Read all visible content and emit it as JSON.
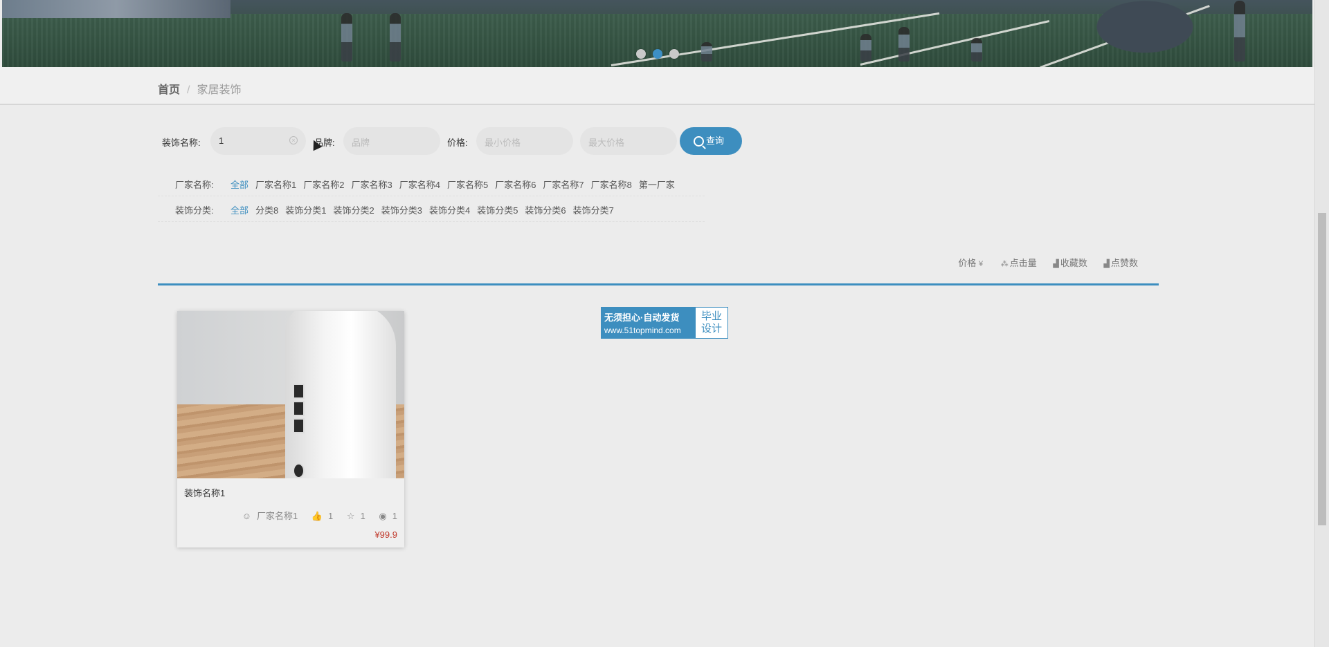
{
  "banner": {
    "active_slide": 2,
    "slide_count": 3
  },
  "breadcrumb": {
    "home": "首页",
    "separator": "/",
    "current": "家居装饰"
  },
  "search": {
    "name_label": "装饰名称:",
    "name_value": "1",
    "brand_label": "品牌:",
    "brand_placeholder": "品牌",
    "price_label": "价格:",
    "min_placeholder": "最小价格",
    "max_placeholder": "最大价格",
    "query_label": "查询"
  },
  "filters": {
    "maker": {
      "label": "厂家名称:",
      "options": [
        "全部",
        "厂家名称1",
        "厂家名称2",
        "厂家名称3",
        "厂家名称4",
        "厂家名称5",
        "厂家名称6",
        "厂家名称7",
        "厂家名称8",
        "第一厂家"
      ],
      "active": "全部"
    },
    "category": {
      "label": "装饰分类:",
      "options": [
        "全部",
        "分类8",
        "装饰分类1",
        "装饰分类2",
        "装饰分类3",
        "装饰分类4",
        "装饰分类5",
        "装饰分类6",
        "装饰分类7"
      ],
      "active": "全部"
    }
  },
  "sort": {
    "price": "价格",
    "price_icon": "¥",
    "clicks": "点击量",
    "favorites": "收藏数",
    "likes": "点赞数"
  },
  "products": [
    {
      "name": "装饰名称1",
      "maker": "厂家名称1",
      "likes": "1",
      "favorites": "1",
      "views": "1",
      "price": "¥99.9"
    }
  ],
  "watermark": {
    "line1": "无须担心·自动发货",
    "line2": "www.51topmind.com",
    "badge_top": "毕业",
    "badge_bottom": "设计"
  },
  "colors": {
    "accent": "#3d8ebf",
    "price": "#c0392b",
    "background": "#ececec"
  }
}
